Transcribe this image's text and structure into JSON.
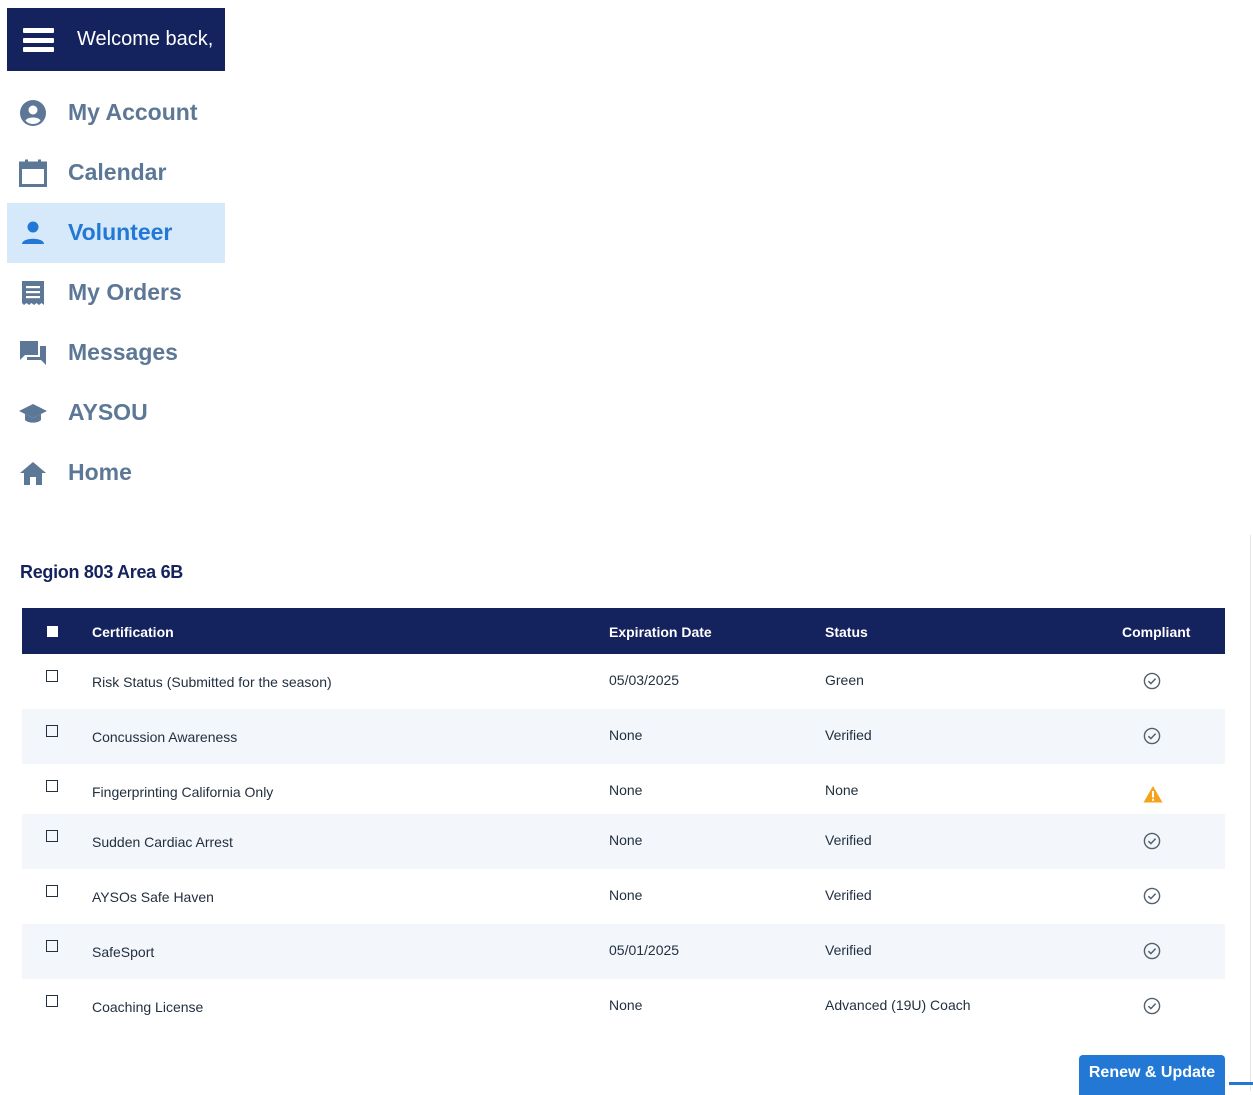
{
  "header": {
    "welcome_text": "Welcome back,"
  },
  "sidebar": {
    "items": [
      {
        "label": "My Account",
        "icon": "account-circle-icon",
        "active": false
      },
      {
        "label": "Calendar",
        "icon": "calendar-icon",
        "active": false
      },
      {
        "label": "Volunteer",
        "icon": "person-icon",
        "active": true
      },
      {
        "label": "My Orders",
        "icon": "receipt-icon",
        "active": false
      },
      {
        "label": "Messages",
        "icon": "chat-icon",
        "active": false
      },
      {
        "label": "AYSOU",
        "icon": "graduation-cap-icon",
        "active": false
      },
      {
        "label": "Home",
        "icon": "home-icon",
        "active": false
      }
    ]
  },
  "region": {
    "title": "Region 803 Area 6B"
  },
  "table": {
    "headers": {
      "certification": "Certification",
      "expiration": "Expiration Date",
      "status": "Status",
      "compliant": "Compliant"
    },
    "rows": [
      {
        "certification": "Risk Status (Submitted for the season)",
        "expiration": "05/03/2025",
        "status": "Green",
        "compliant": "check-circle-icon"
      },
      {
        "certification": "Concussion Awareness",
        "expiration": "None",
        "status": "Verified",
        "compliant": "check-circle-icon"
      },
      {
        "certification": "Fingerprinting California Only",
        "expiration": "None",
        "status": "None",
        "compliant": "warning-icon"
      },
      {
        "certification": "Sudden Cardiac Arrest",
        "expiration": "None",
        "status": "Verified",
        "compliant": "check-circle-icon"
      },
      {
        "certification": "AYSOs Safe Haven",
        "expiration": "None",
        "status": "Verified",
        "compliant": "check-circle-icon"
      },
      {
        "certification": "SafeSport",
        "expiration": "05/01/2025",
        "status": "Verified",
        "compliant": "check-circle-icon"
      },
      {
        "certification": "Coaching License",
        "expiration": "None",
        "status": "Advanced (19U) Coach",
        "compliant": "check-circle-icon"
      }
    ]
  },
  "actions": {
    "renew_label": "Renew & Update"
  },
  "colors": {
    "navy": "#14225e",
    "accent_blue": "#2278d4",
    "nav_gray": "#5d7896",
    "active_bg": "#d6e9fb",
    "warning": "#f4a31b"
  }
}
